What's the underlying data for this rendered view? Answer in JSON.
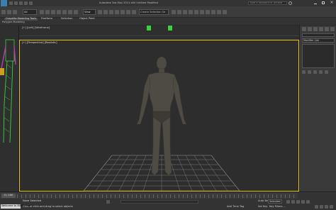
{
  "window": {
    "title": "Autodesk 3ds Max 2014 x64   Untitled   Modified",
    "search_placeholder": "Type a keyword or phrase"
  },
  "toolbar": {
    "view_select": "View",
    "selection_set": "Create Selection Se"
  },
  "ribbon": {
    "tabs": [
      "Graphite Modeling Tools",
      "Freeform",
      "Selection",
      "Object Paint"
    ],
    "section_label": "Polygon Modeling"
  },
  "top_viewport": {
    "label": "[+] [Left] [Wireframe]"
  },
  "main_viewport": {
    "label": "[+] [Perspective] [Realistic]"
  },
  "command_panel": {
    "modifier_list": "Modifier List"
  },
  "timeline": {
    "position": "0 / 100"
  },
  "status": {
    "selection": "None Selected",
    "prompt": "Click or click-and-drag to select objects",
    "welcome": "Welcome to MAXScript.",
    "autokey": "Auto Key",
    "selected": "Selected",
    "setkey": "Set Key",
    "keyfilters": "Key Filters...",
    "add_time_tag": "Add Time Tag"
  },
  "colors": {
    "viewport_border": "#e6c700",
    "wire_green": "#3ad13a",
    "wire_purple": "#b33ab3"
  }
}
